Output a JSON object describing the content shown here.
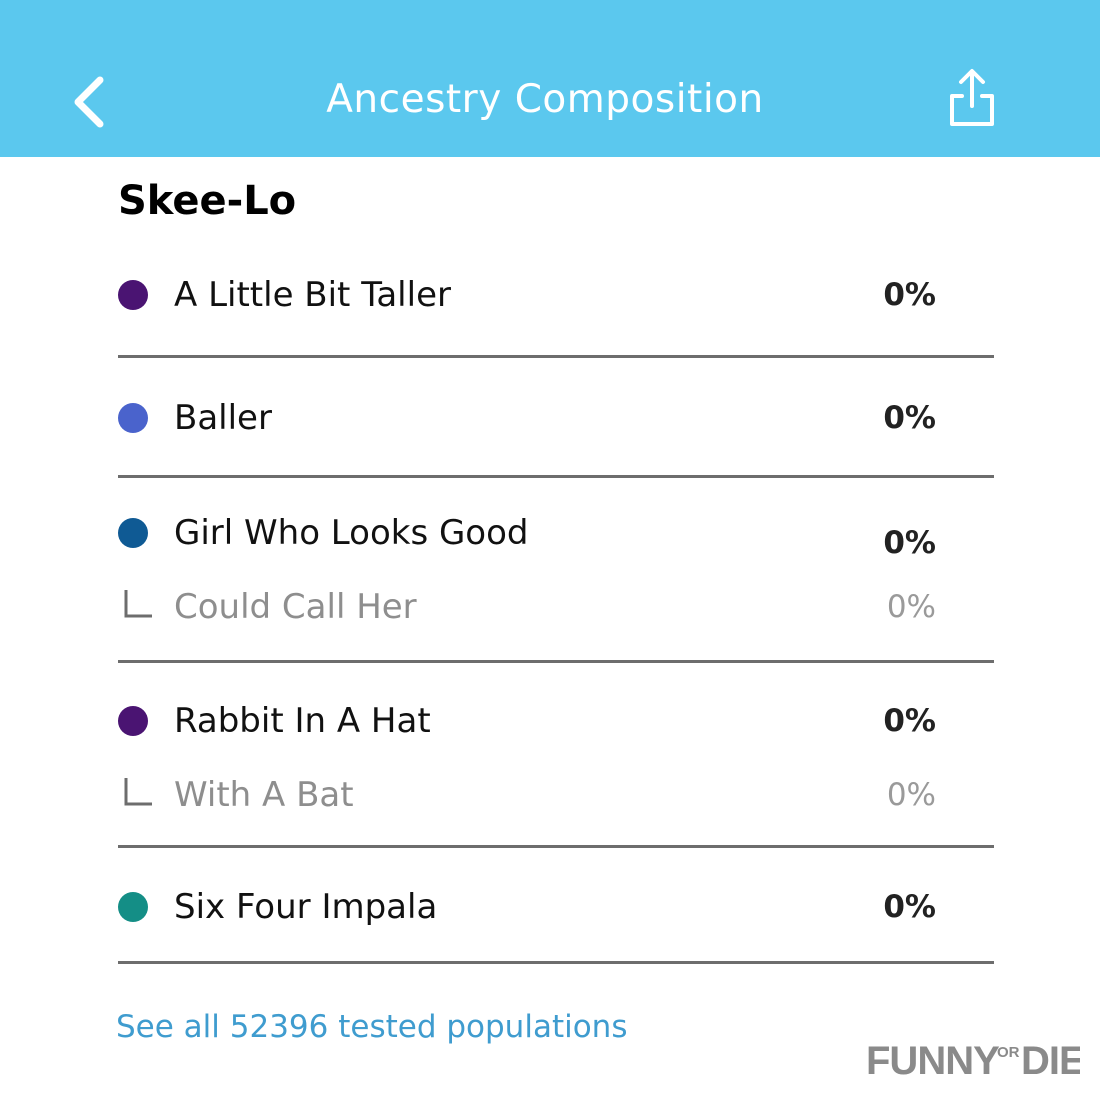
{
  "header": {
    "title": "Ancestry Composition",
    "background_color": "#5bc8ee",
    "back_icon": "chevron-left-icon",
    "share_icon": "share-icon"
  },
  "section": {
    "title": "Skee-Lo"
  },
  "populations": [
    {
      "label": "A Little Bit Taller",
      "percent": "0%",
      "color": "#4a1472"
    },
    {
      "label": "Baller",
      "percent": "0%",
      "color": "#4a63cc"
    },
    {
      "label": "Girl Who Looks Good",
      "percent": "0%",
      "color": "#0f5a94",
      "sub": {
        "label": "Could Call Her",
        "percent": "0%"
      }
    },
    {
      "label": "Rabbit In A Hat",
      "percent": "0%",
      "color": "#4a1472",
      "sub": {
        "label": "With A Bat",
        "percent": "0%"
      }
    },
    {
      "label": "Six Four Impala",
      "percent": "0%",
      "color": "#148e86"
    }
  ],
  "footer": {
    "see_all": "See all 52396 tested populations",
    "link_color": "#3f9ccf"
  },
  "watermark": {
    "text": "FUNNY OR DIE"
  }
}
